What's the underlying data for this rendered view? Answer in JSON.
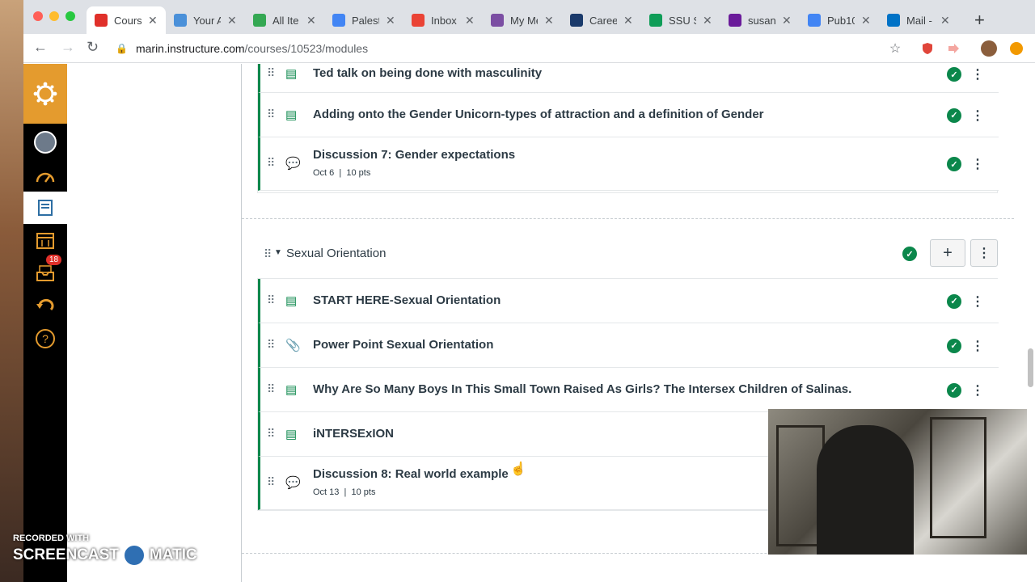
{
  "browser": {
    "tabs": [
      {
        "label": "Cours",
        "fav_color": "#e0302a",
        "active": true
      },
      {
        "label": "Your A",
        "fav_color": "#4a90d9"
      },
      {
        "label": "All Ite",
        "fav_color": "#34a853"
      },
      {
        "label": "Palest",
        "fav_color": "#4285f4"
      },
      {
        "label": "Inbox",
        "fav_color": "#ea4335"
      },
      {
        "label": "My Me",
        "fav_color": "#7b4ea3"
      },
      {
        "label": "Caree",
        "fav_color": "#1a3a6b"
      },
      {
        "label": "SSU S",
        "fav_color": "#0f9d58"
      },
      {
        "label": "susan",
        "fav_color": "#6a1b9a"
      },
      {
        "label": "Pub10",
        "fav_color": "#4285f4"
      },
      {
        "label": "Mail -",
        "fav_color": "#0072c6"
      }
    ],
    "url_host": "marin.instructure.com",
    "url_path": "/courses/10523/modules"
  },
  "global_nav": {
    "inbox_badge": "18"
  },
  "modules": {
    "prev_items": [
      {
        "title": "Ted talk on being done with masculinity",
        "type": "page",
        "meta": ""
      },
      {
        "title": "Adding onto the Gender Unicorn-types of attraction and a definition of Gender",
        "type": "page",
        "meta": ""
      },
      {
        "title": "Discussion 7: Gender expectations",
        "type": "discussion",
        "meta": "Oct 6  |  10 pts"
      }
    ],
    "current_module_title": "Sexual Orientation",
    "items": [
      {
        "title": "START HERE-Sexual Orientation",
        "type": "page",
        "meta": ""
      },
      {
        "title": "Power Point Sexual Orientation",
        "type": "attachment",
        "meta": ""
      },
      {
        "title": "Why Are So Many Boys In This Small Town Raised As Girls? The Intersex Children of Salinas.",
        "type": "page",
        "meta": ""
      },
      {
        "title": "iNTERSExION",
        "type": "page",
        "meta": ""
      },
      {
        "title": "Discussion 8: Real world example",
        "type": "discussion",
        "meta": "Oct 13  |  10 pts"
      }
    ]
  },
  "watermark": {
    "line1": "RECORDED WITH",
    "line2a": "SCREENCAST",
    "line2b": "MATIC"
  },
  "colors": {
    "canvas_orange": "#e49b2e",
    "module_green": "#0b874b",
    "text_dark": "#2d3b45"
  }
}
